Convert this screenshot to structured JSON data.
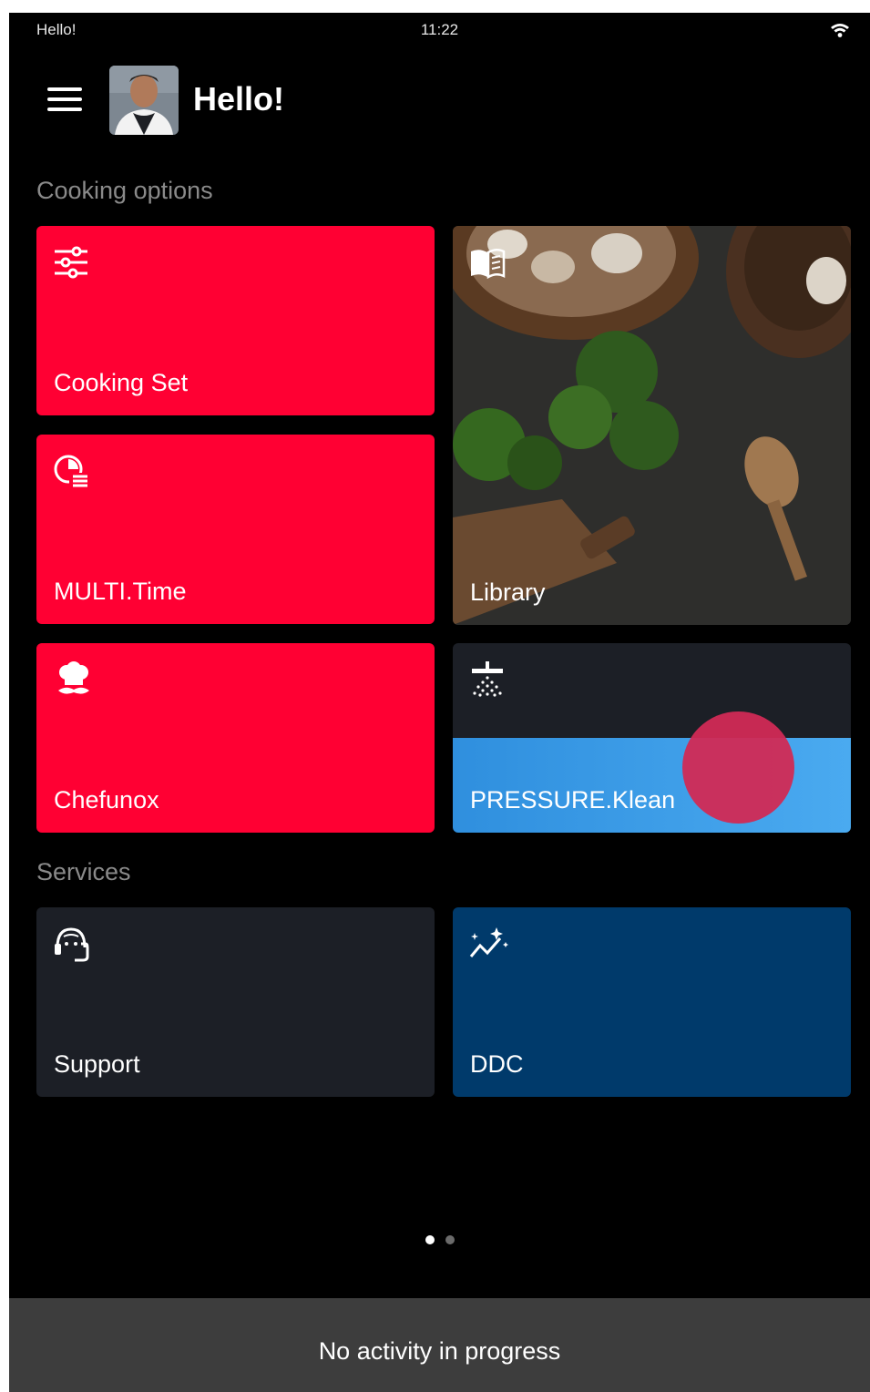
{
  "status_bar": {
    "left_text": "Hello!",
    "time": "11:22",
    "wifi_icon": "wifi-icon"
  },
  "header": {
    "title": "Hello!",
    "menu_icon": "hamburger-menu-icon",
    "avatar": "chef-avatar"
  },
  "sections": {
    "cooking_options": "Cooking options",
    "services": "Services"
  },
  "tiles": {
    "cooking_set": {
      "label": "Cooking Set",
      "icon": "sliders-icon",
      "color": "#ff0033"
    },
    "multi_time": {
      "label": "MULTI.Time",
      "icon": "timer-list-icon",
      "color": "#ff0033"
    },
    "library": {
      "label": "Library",
      "icon": "book-icon"
    },
    "chefunox": {
      "label": "Chefunox",
      "icon": "chef-hat-icon",
      "color": "#ff0033"
    },
    "pressure_klean": {
      "label": "PRESSURE.Klean",
      "icon": "shower-icon",
      "color": "#3a9ae6"
    },
    "support": {
      "label": "Support",
      "icon": "headset-icon",
      "color": "#1c1f26"
    },
    "ddc": {
      "label": "DDC",
      "icon": "sparkle-chart-icon",
      "color": "#003a6b"
    }
  },
  "pager": {
    "pages": 2,
    "active": 1
  },
  "footer": {
    "text": "No activity in progress"
  }
}
